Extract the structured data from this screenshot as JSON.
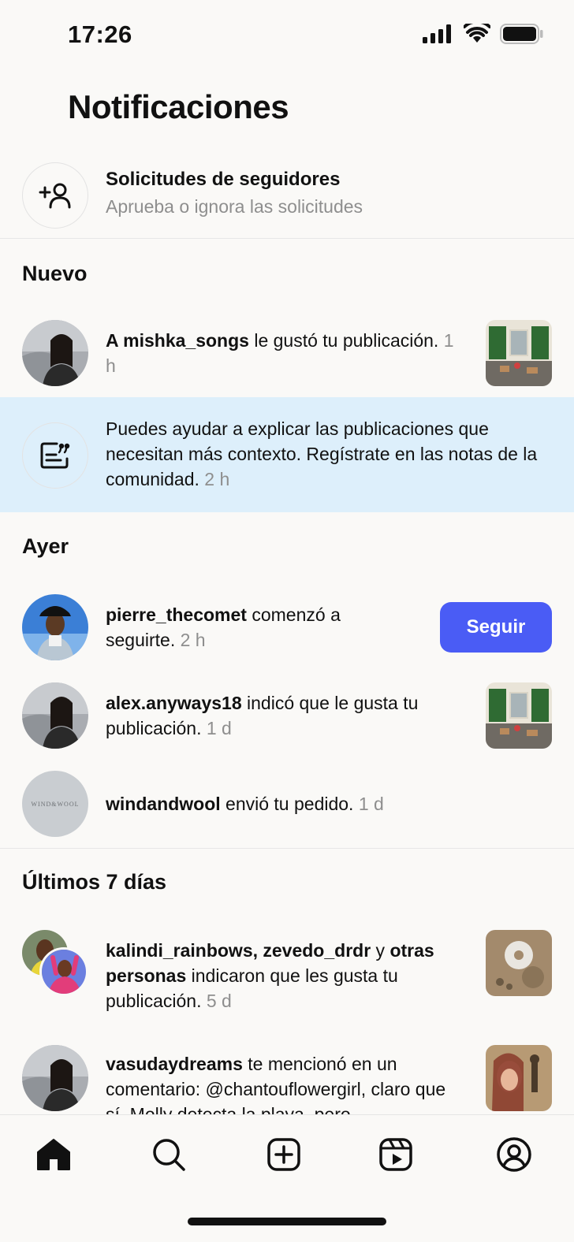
{
  "status": {
    "time": "17:26"
  },
  "header": {
    "title": "Notificaciones"
  },
  "requests": {
    "title": "Solicitudes de seguidores",
    "subtitle": "Aprueba o ignora las solicitudes"
  },
  "sections": {
    "new": "Nuevo",
    "yesterday": "Ayer",
    "last7": "Últimos 7 días"
  },
  "notifications": [
    {
      "user": "A mishka_songs",
      "text": " le gustó tu publicación.",
      "time": " 1 h"
    },
    {
      "user": "",
      "text": "Puedes ayudar a explicar las publicaciones que necesitan más contexto. Regístrate en las notas de la comunidad.",
      "time": " 2 h"
    },
    {
      "user": "pierre_thecomet",
      "text": " comenzó a seguirte.",
      "time": " 2 h",
      "button": "Seguir"
    },
    {
      "user": "alex.anyways18",
      "text": " indicó que le gusta tu publicación.",
      "time": " 1 d"
    },
    {
      "user": "windandwool",
      "text": " envió tu pedido.",
      "time": " 1 d",
      "avatar_text": "WIND&WOOL"
    },
    {
      "user": "kalindi_rainbows, zevedo_drdr",
      "mid": " y ",
      "user2": "otras personas",
      "text": " indicaron que les gusta tu publicación.",
      "time": " 5 d"
    },
    {
      "user": "vasudaydreams",
      "text": " te mencionó en un comentario: @chantouflowergirl, claro que sí. Molly detecta la playa, pero"
    }
  ],
  "tabs": [
    "home-icon",
    "search-icon",
    "create-icon",
    "reels-icon",
    "profile-icon"
  ],
  "colors": {
    "accent": "#4a5cf5",
    "highlight": "#ddeffb",
    "background": "#faf9f7"
  }
}
